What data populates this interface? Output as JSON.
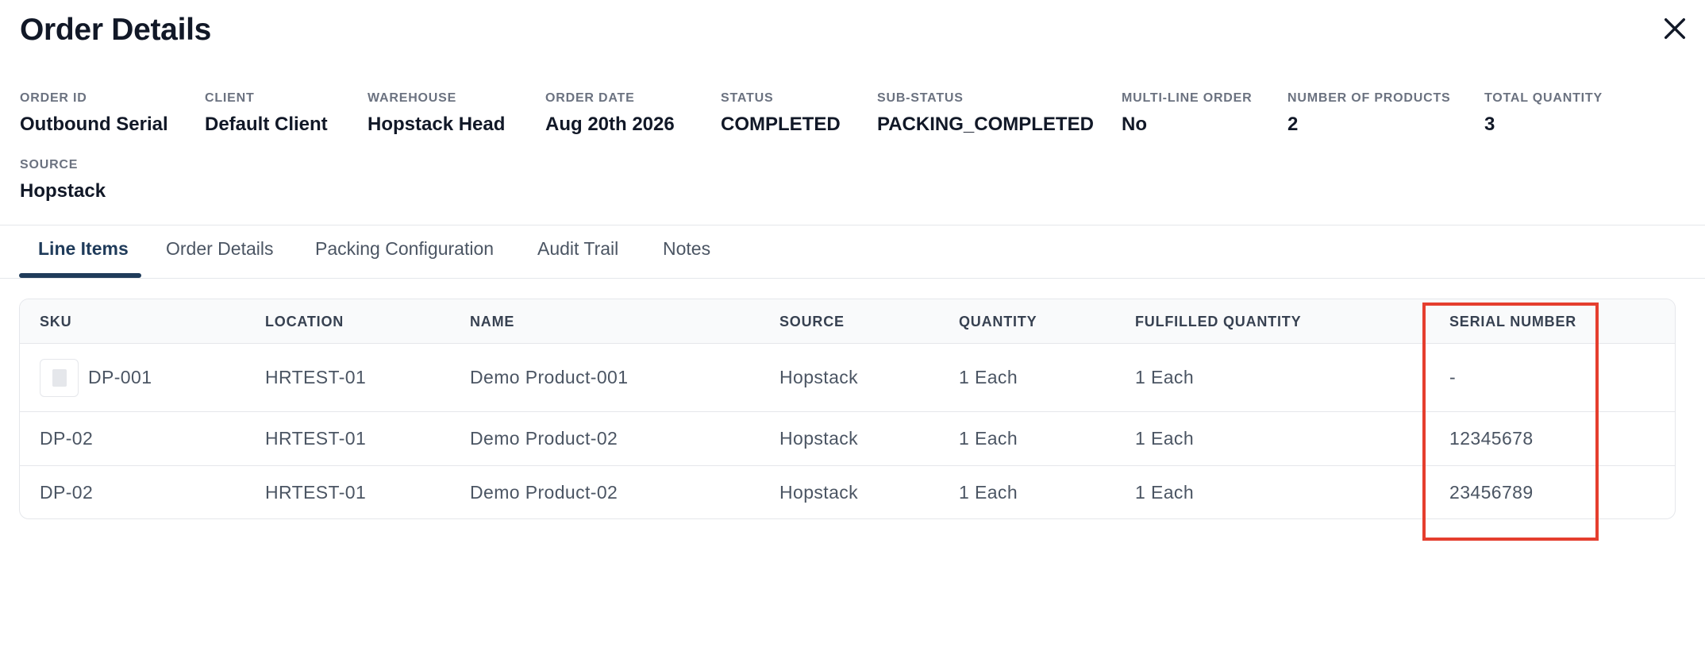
{
  "page": {
    "title": "Order Details"
  },
  "meta": {
    "order_id": {
      "label": "ORDER ID",
      "value": "Outbound Serial"
    },
    "client": {
      "label": "CLIENT",
      "value": "Default Client"
    },
    "warehouse": {
      "label": "WAREHOUSE",
      "value": "Hopstack Head"
    },
    "order_date": {
      "label": "ORDER DATE",
      "value": "Aug 20th 2026"
    },
    "status": {
      "label": "STATUS",
      "value": "COMPLETED"
    },
    "sub_status": {
      "label": "SUB-STATUS",
      "value": "PACKING_COMPLETED"
    },
    "multi_line": {
      "label": "MULTI-LINE ORDER",
      "value": "No"
    },
    "num_products": {
      "label": "NUMBER OF PRODUCTS",
      "value": "2"
    },
    "total_quantity": {
      "label": "TOTAL QUANTITY",
      "value": "3"
    },
    "source": {
      "label": "SOURCE",
      "value": "Hopstack"
    }
  },
  "tabs": [
    {
      "label": "Line Items",
      "active": true
    },
    {
      "label": "Order Details"
    },
    {
      "label": "Packing Configuration"
    },
    {
      "label": "Audit Trail"
    },
    {
      "label": "Notes"
    }
  ],
  "table": {
    "headers": [
      "SKU",
      "LOCATION",
      "NAME",
      "SOURCE",
      "QUANTITY",
      "FULFILLED QUANTITY",
      "SERIAL NUMBER"
    ],
    "rows": [
      [
        "DP-001",
        "HRTEST-01",
        "Demo Product-001",
        "Hopstack",
        "1 Each",
        "1 Each",
        "-"
      ],
      [
        "DP-02",
        "HRTEST-01",
        "Demo Product-02",
        "Hopstack",
        "1 Each",
        "1 Each",
        "12345678"
      ],
      [
        "DP-02",
        "HRTEST-01",
        "Demo Product-02",
        "Hopstack",
        "1 Each",
        "1 Each",
        "23456789"
      ]
    ]
  },
  "colors": {
    "accent": "#1f3b5a",
    "highlight": "#e53e2e"
  },
  "icons": {
    "close": "close-icon",
    "product_thumbnail": "image-placeholder-icon"
  }
}
